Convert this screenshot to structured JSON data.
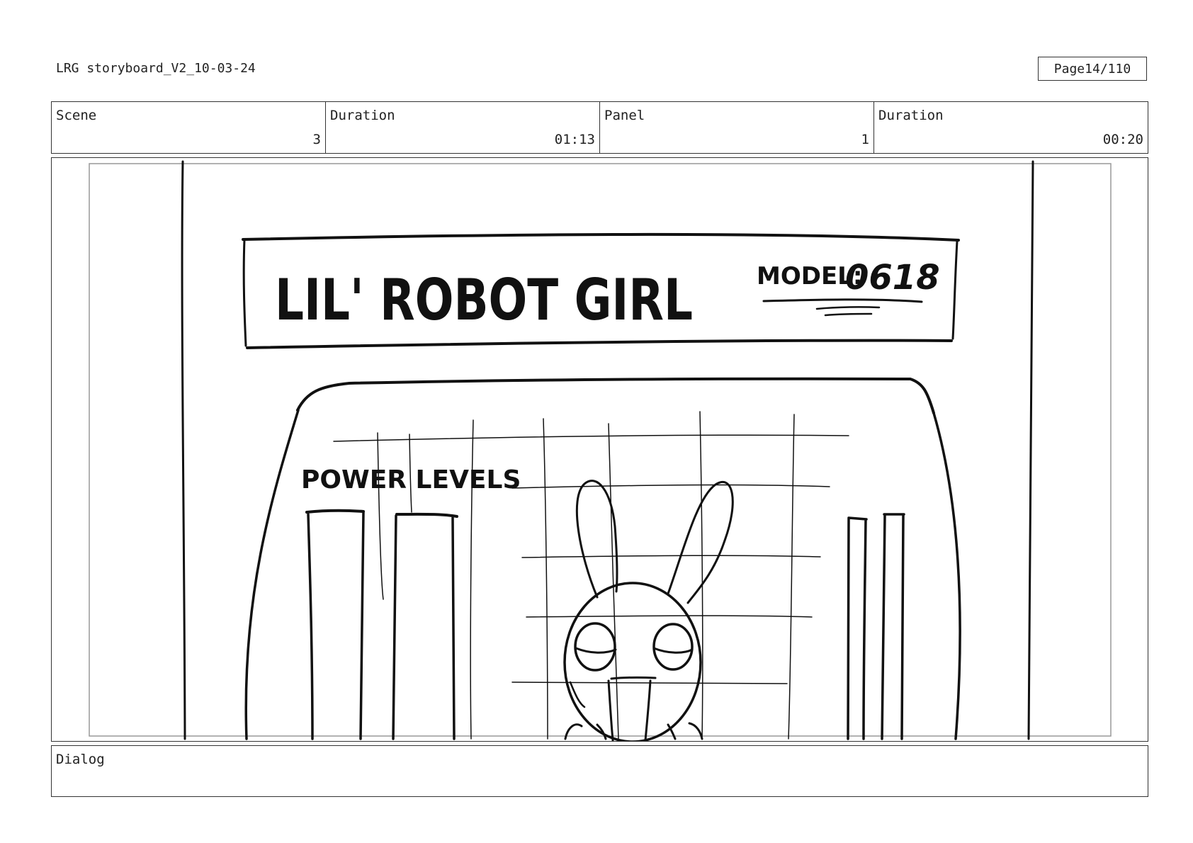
{
  "header": {
    "doc_title": "LRG storyboard_V2_10-03-24",
    "page_label": "Page",
    "page_value": "14/110"
  },
  "info": {
    "scene_label": "Scene",
    "scene_value": "3",
    "scene_duration_label": "Duration",
    "scene_duration_value": "01:13",
    "panel_label": "Panel",
    "panel_value": "1",
    "panel_duration_label": "Duration",
    "panel_duration_value": "00:20"
  },
  "sketch": {
    "sign_title": "LIL' ROBOT GIRL",
    "model_label": "MODEL:",
    "model_number": "0618",
    "power_label": "POWER LEVELS"
  },
  "dialog": {
    "label": "Dialog",
    "text": ""
  }
}
